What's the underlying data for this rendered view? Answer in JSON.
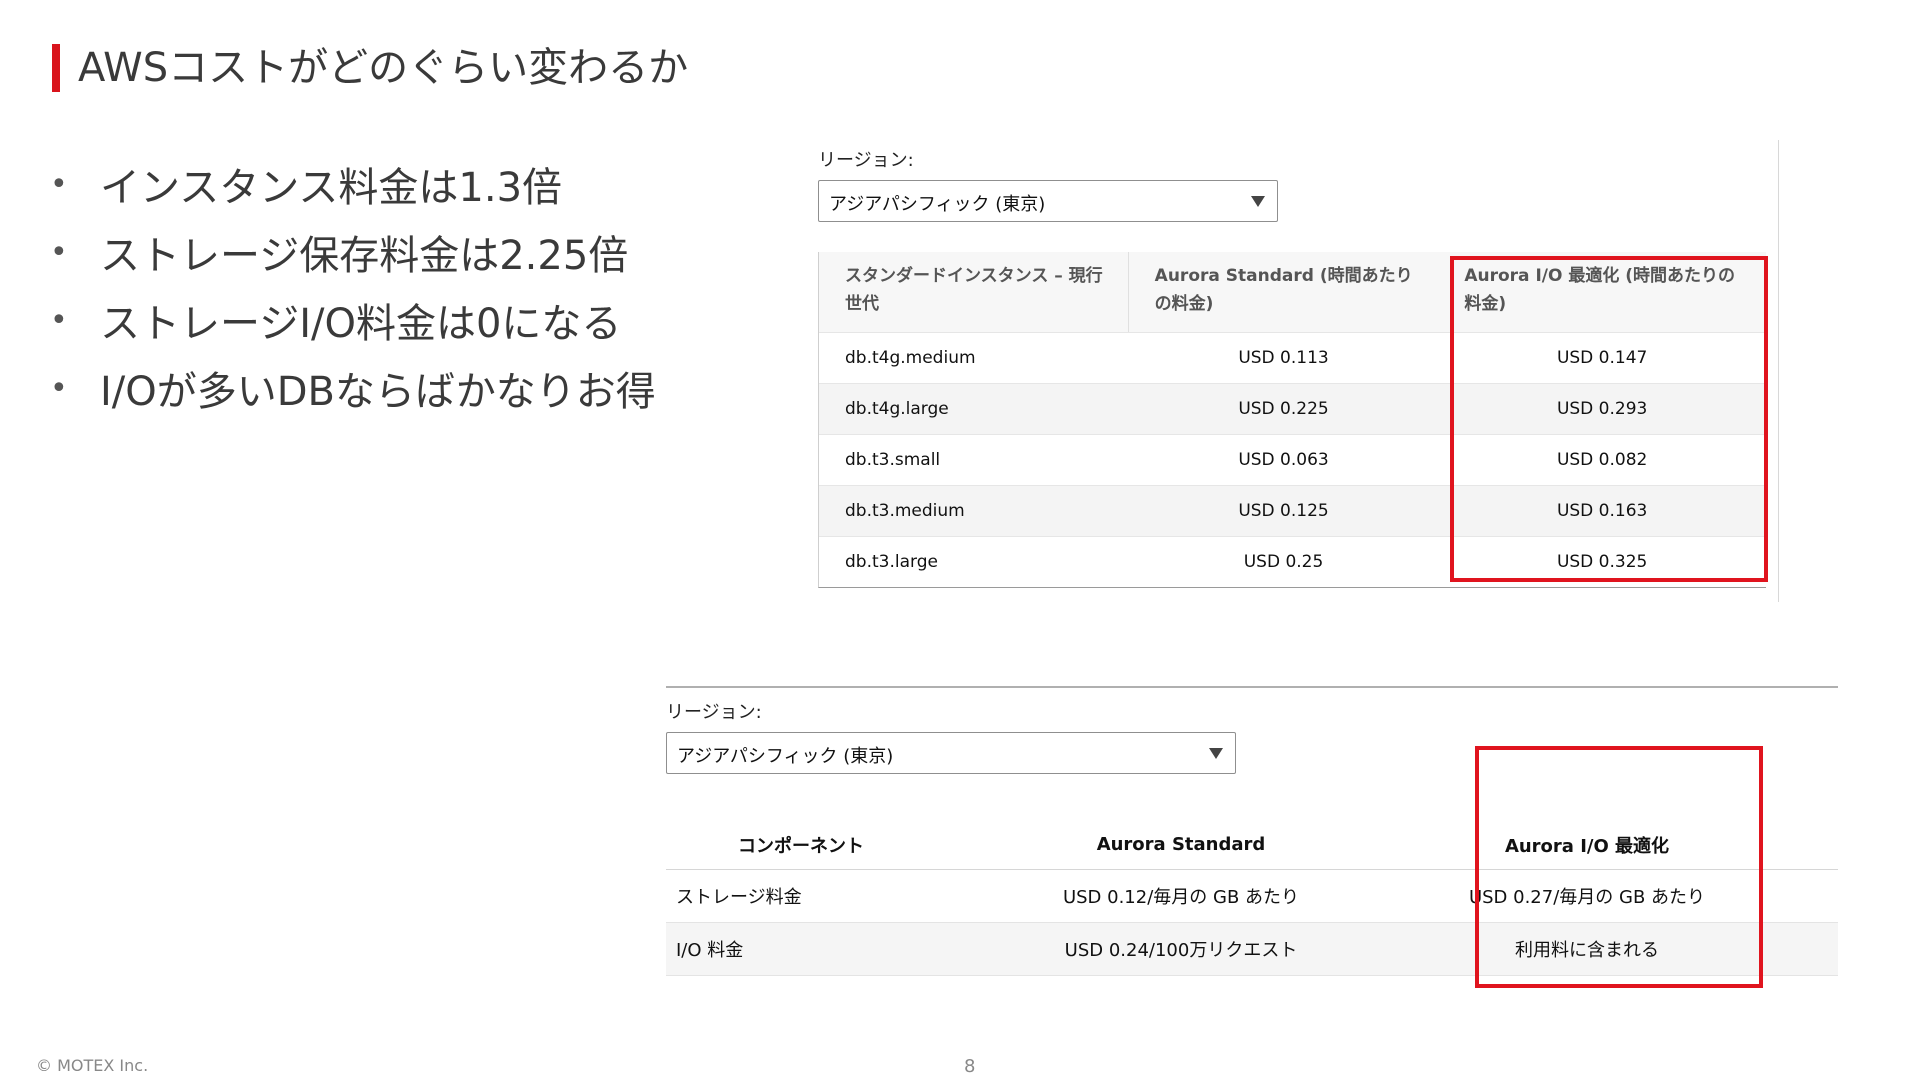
{
  "slide": {
    "title": "AWSコストがどのぐらい変わるか",
    "accent_color": "#d9141c"
  },
  "bullets": [
    "インスタンス料金は1.3倍",
    "ストレージ保存料金は2.25倍",
    "ストレージI/O料金は0になる",
    "I/Oが多いDBならばかなりお得"
  ],
  "instance_pricing": {
    "region_label": "リージョン:",
    "region_value": "アジアパシフィック (東京)",
    "headers": [
      "スタンダードインスタンス – 現行世代",
      "Aurora Standard (時間あたりの料金)",
      "Aurora I/O 最適化 (時間あたりの料金)"
    ],
    "rows": [
      [
        "db.t4g.medium",
        "USD 0.113",
        "USD 0.147"
      ],
      [
        "db.t4g.large",
        "USD 0.225",
        "USD 0.293"
      ],
      [
        "db.t3.small",
        "USD 0.063",
        "USD 0.082"
      ],
      [
        "db.t3.medium",
        "USD 0.125",
        "USD 0.163"
      ],
      [
        "db.t3.large",
        "USD 0.25",
        "USD 0.325"
      ]
    ]
  },
  "storage_pricing": {
    "region_label": "リージョン:",
    "region_value": "アジアパシフィック (東京)",
    "headers": [
      "コンポーネント",
      "Aurora Standard",
      "Aurora I/O 最適化"
    ],
    "rows": [
      [
        "ストレージ料金",
        "USD 0.12/毎月の GB あたり",
        "USD 0.27/毎月の GB あたり"
      ],
      [
        "I/O 料金",
        "USD 0.24/100万リクエスト",
        "利用料に含まれる"
      ]
    ]
  },
  "highlight_color": "#e0141e",
  "footer": {
    "copyright": "© MOTEX Inc.",
    "page": "8"
  }
}
